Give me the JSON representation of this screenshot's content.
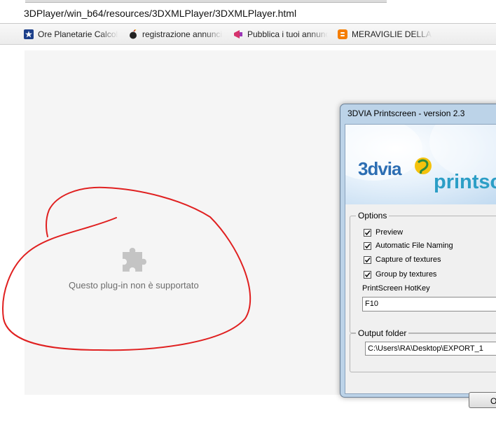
{
  "browser": {
    "url": "3DPlayer/win_b64/resources/3DXMLPlayer/3DXMLPlayer.html",
    "bookmarks": [
      {
        "label": "Ore Planetarie Calcolo",
        "icon": "star-globe-icon"
      },
      {
        "label": "registrazione annunci",
        "icon": "bomb-icon"
      },
      {
        "label": "Pubblica i tuoi annunci",
        "icon": "megaphone-icon"
      },
      {
        "label": "MERAVIGLIE DELLA S",
        "icon": "blogger-icon",
        "color": "#f57d00"
      }
    ]
  },
  "plugin": {
    "message": "Questo plug-in non è supportato",
    "icon": "puzzle-piece-icon"
  },
  "annotation": {
    "color": "#e02020"
  },
  "dialog": {
    "title": "3DVIA Printscreen - version 2.3",
    "logo_left": "3dvia",
    "logo_right": "printscr",
    "options": {
      "title": "Options",
      "checkboxes": [
        {
          "label": "Preview",
          "checked": true
        },
        {
          "label": "Automatic File Naming",
          "checked": true
        },
        {
          "label": "Capture of textures",
          "checked": true
        },
        {
          "label": "Group by textures",
          "checked": true
        }
      ],
      "hotkey_label": "PrintScreen HotKey",
      "hotkey_value": "F10"
    },
    "output": {
      "title": "Output folder",
      "path": "C:\\Users\\RA\\Desktop\\EXPORT_1"
    },
    "ok_label": "Ok"
  }
}
